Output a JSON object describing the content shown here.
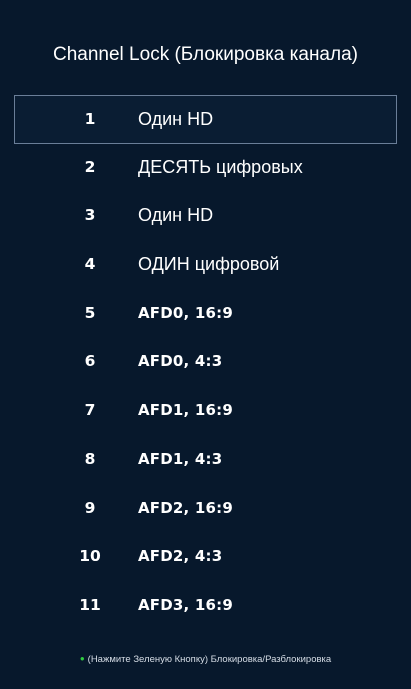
{
  "title": "Channel Lock (Блокировка канала)",
  "channels": [
    {
      "number": "1",
      "name": "Один HD"
    },
    {
      "number": "2",
      "name": "ДЕСЯТЬ цифровых"
    },
    {
      "number": "3",
      "name": "Один HD"
    },
    {
      "number": "4",
      "name": "ОДИН цифровой"
    },
    {
      "number": "5",
      "name": "AFD0, 16:9"
    },
    {
      "number": "6",
      "name": "AFD0, 4:3"
    },
    {
      "number": "7",
      "name": "AFD1, 16:9"
    },
    {
      "number": "8",
      "name": "AFD1, 4:3"
    },
    {
      "number": "9",
      "name": "AFD2, 16:9"
    },
    {
      "number": "10",
      "name": "AFD2, 4:3"
    },
    {
      "number": "11",
      "name": "AFD3, 16:9"
    }
  ],
  "selected_index": 0,
  "hint": {
    "text": "(Нажмите Зеленую Кнопку) Блокировка/Разблокировка",
    "bullet_icon": "green-bullet-icon",
    "bullet_color": "#2ecc40"
  },
  "colors": {
    "background": "#07182c",
    "selection_border": "#6a7e98",
    "text": "#ffffff"
  }
}
